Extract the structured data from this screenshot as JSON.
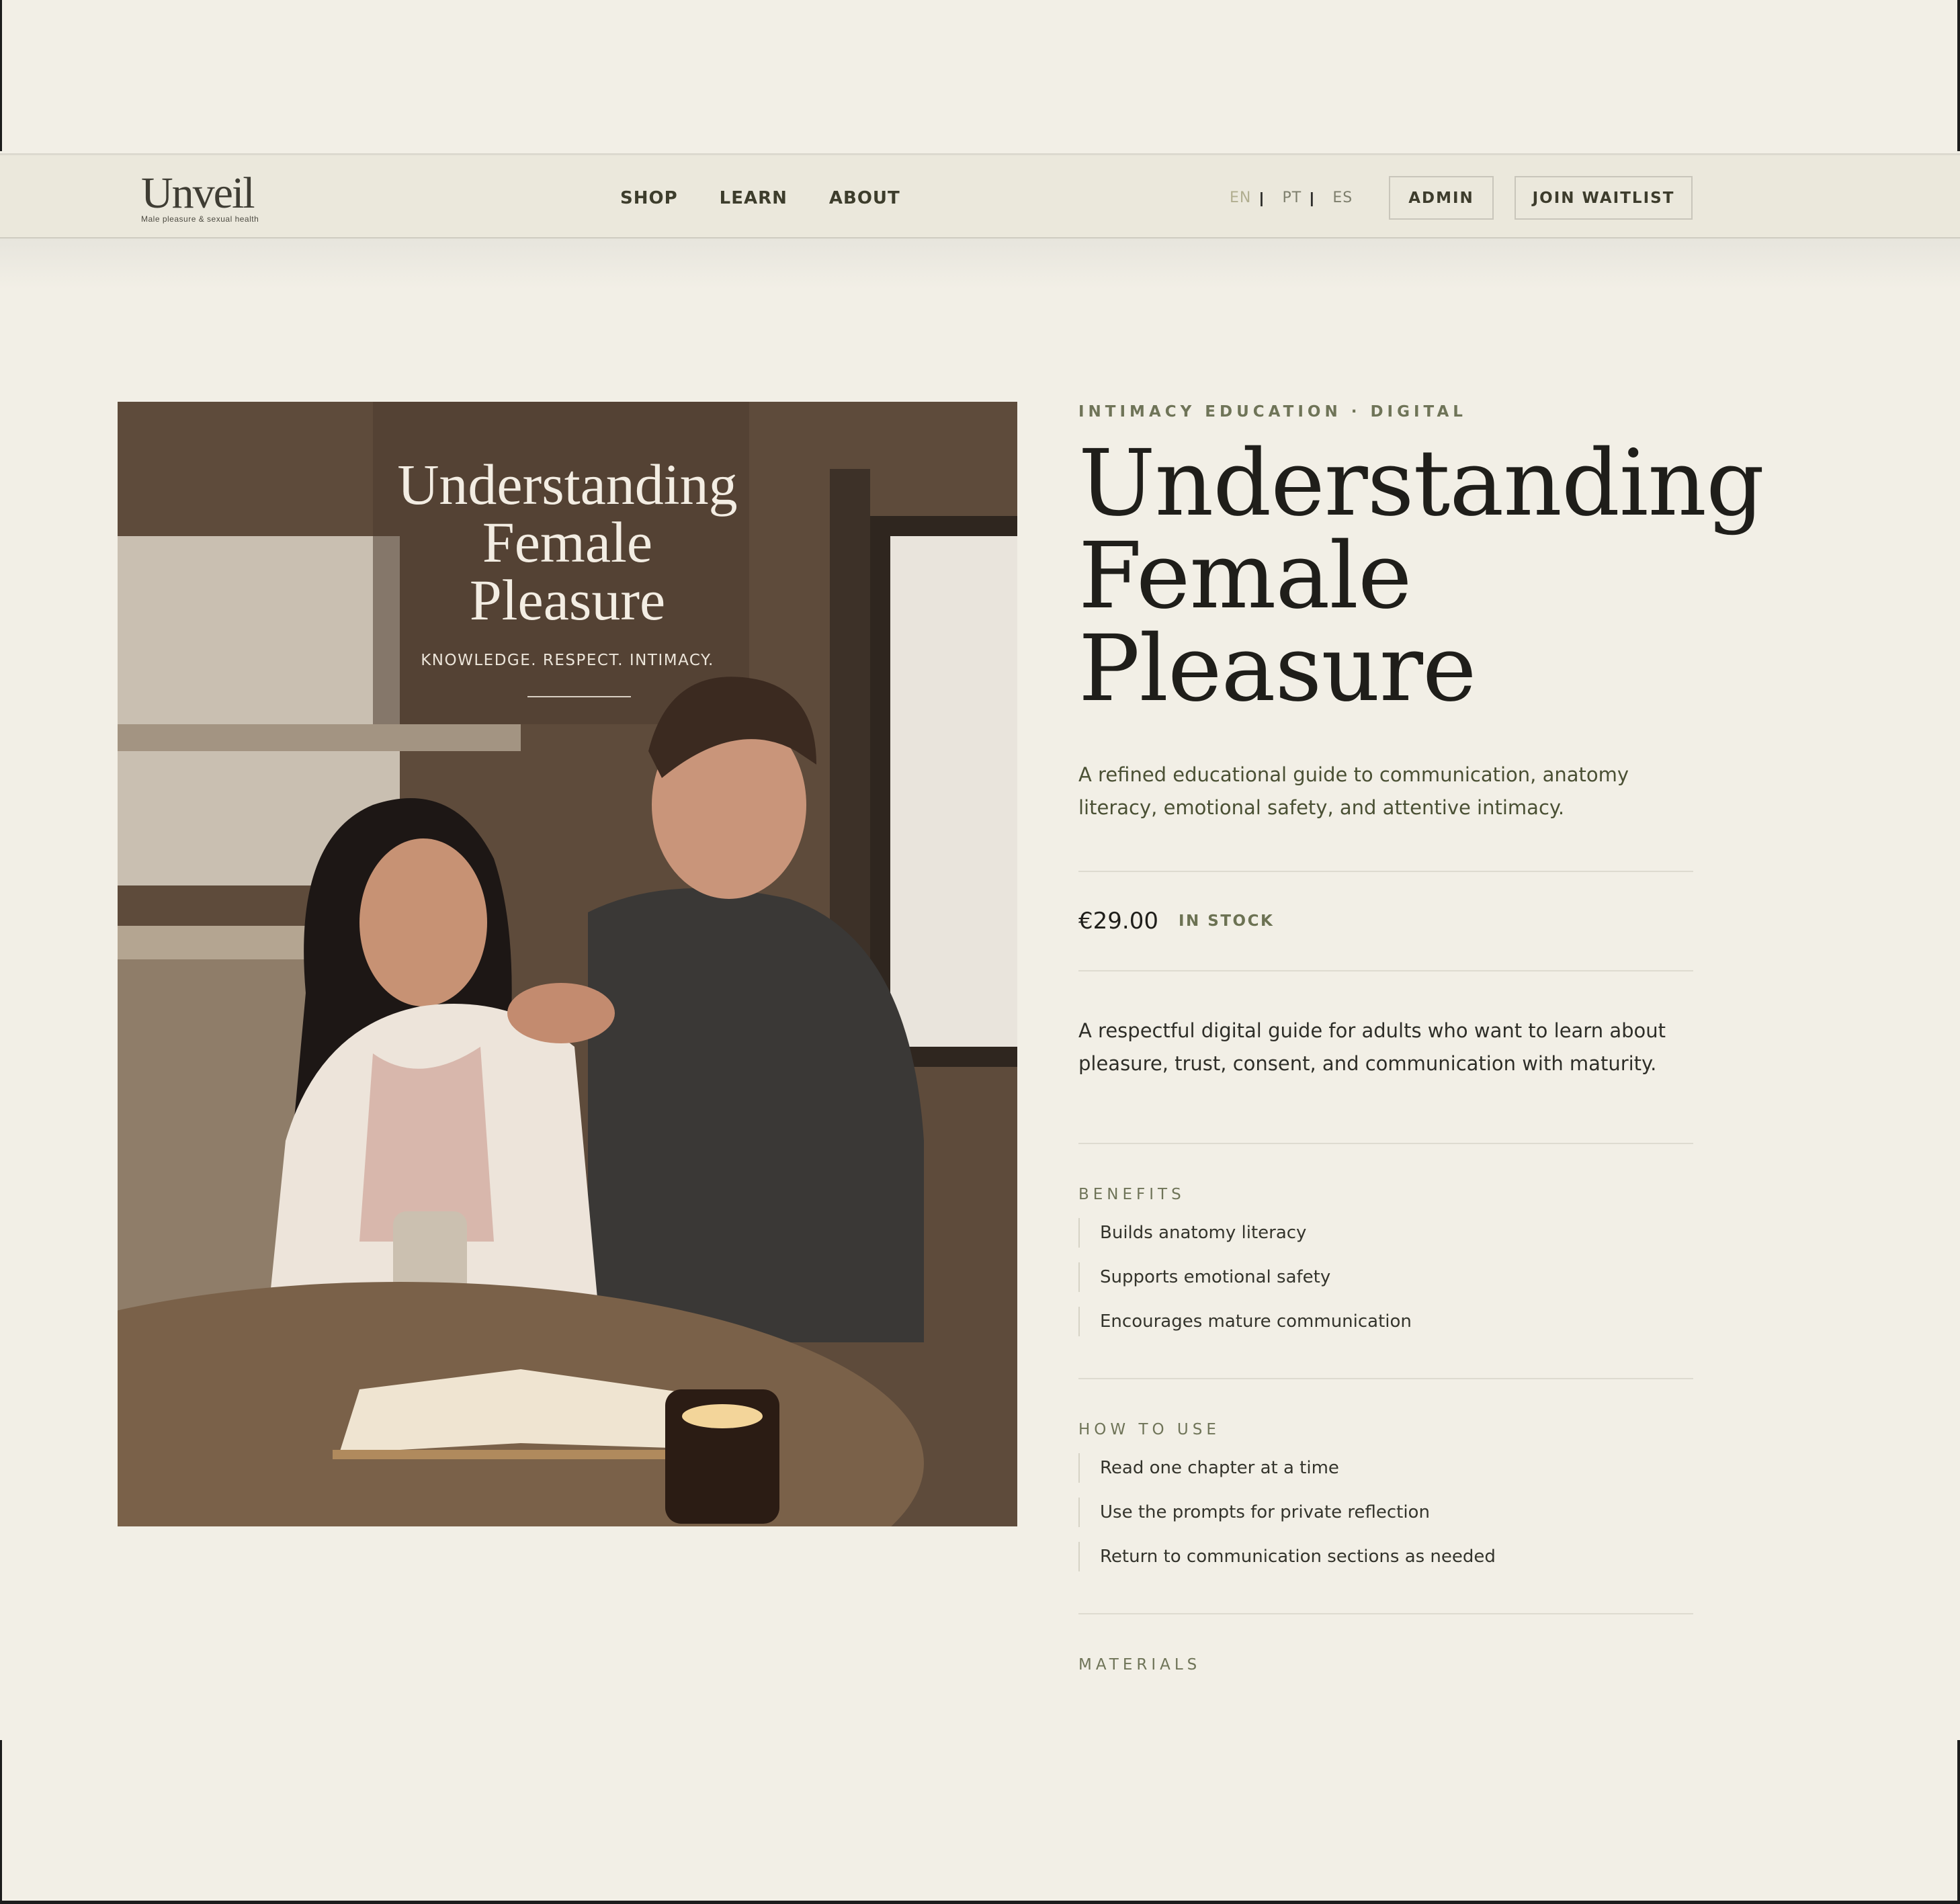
{
  "header": {
    "logo": {
      "wordmark": "Unveil",
      "tagline": "Male pleasure & sexual health"
    },
    "nav": [
      {
        "label": "SHOP"
      },
      {
        "label": "LEARN"
      },
      {
        "label": "ABOUT"
      }
    ],
    "languages": [
      {
        "label": "EN",
        "active": true
      },
      {
        "label": "PT",
        "active": false
      },
      {
        "label": "ES",
        "active": false
      }
    ],
    "lang_separator": "|",
    "admin_label": "ADMIN",
    "waitlist_label": "JOIN WAITLIST"
  },
  "product": {
    "image": {
      "cover_title": [
        "Understanding",
        "Female",
        "Pleasure"
      ],
      "cover_subtitle": "KNOWLEDGE. RESPECT. INTIMACY."
    },
    "eyebrow": "INTIMACY EDUCATION · DIGITAL",
    "title": [
      "Understanding",
      "Female",
      "Pleasure"
    ],
    "lead": "A refined educational guide to communication, anatomy literacy, emotional safety, and attentive intimacy.",
    "price": "€29.00",
    "stock": "IN STOCK",
    "description": "A respectful digital guide for adults who want to learn about pleasure, trust, consent, and communication with maturity.",
    "benefits": {
      "label": "BENEFITS",
      "items": [
        "Builds anatomy literacy",
        "Supports emotional safety",
        "Encourages mature communication"
      ]
    },
    "how_to_use": {
      "label": "HOW TO USE",
      "items": [
        "Read one chapter at a time",
        "Use the prompts for private reflection",
        "Return to communication sections as needed"
      ]
    },
    "materials": {
      "label": "MATERIALS"
    }
  },
  "colors": {
    "background": "#f2efe6",
    "header": "#ebe8dc",
    "accent_olive": "#6f7458",
    "text_dark": "#1f1e1a"
  }
}
